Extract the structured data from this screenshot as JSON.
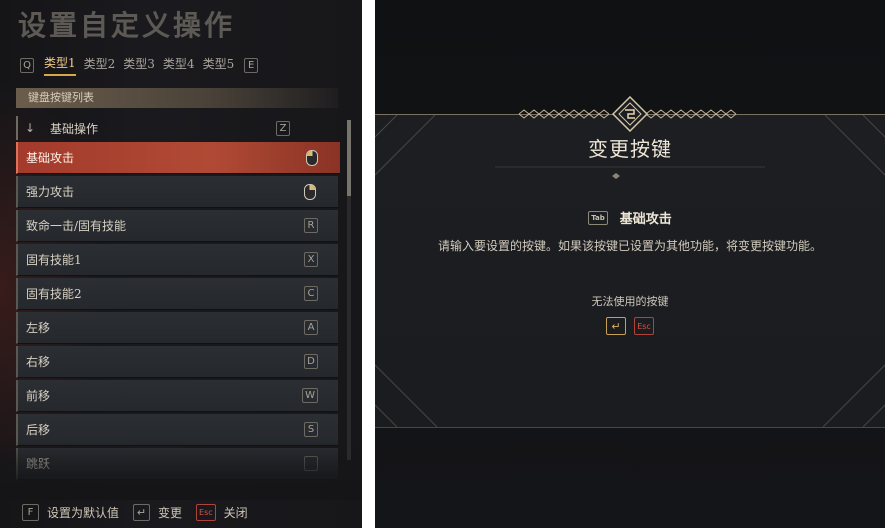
{
  "left_panel": {
    "title": "设置自定义操作",
    "tab_prev_key": "Q",
    "tab_next_key": "E",
    "tabs": [
      "类型1",
      "类型2",
      "类型3",
      "类型4",
      "类型5"
    ],
    "active_tab": 0,
    "section_header": "键盘按键列表",
    "category": {
      "label": "基础操作",
      "key": "Z",
      "icon": "arrow-down-icon"
    },
    "actions": [
      {
        "label": "基础攻击",
        "key": "",
        "icon": "mouse-left-icon",
        "selected": true
      },
      {
        "label": "强力攻击",
        "key": "",
        "icon": "mouse-right-icon",
        "selected": false
      },
      {
        "label": "致命一击/固有技能",
        "key": "R",
        "selected": false
      },
      {
        "label": "固有技能1",
        "key": "X",
        "selected": false
      },
      {
        "label": "固有技能2",
        "key": "C",
        "selected": false
      },
      {
        "label": "左移",
        "key": "A",
        "selected": false
      },
      {
        "label": "右移",
        "key": "D",
        "selected": false
      },
      {
        "label": "前移",
        "key": "W",
        "selected": false
      },
      {
        "label": "后移",
        "key": "S",
        "selected": false
      },
      {
        "label": "跳跃",
        "key": "",
        "selected": false
      }
    ],
    "footer": [
      {
        "key": "F",
        "label": "设置为默认值"
      },
      {
        "key": "↵",
        "label": "变更"
      },
      {
        "key": "Esc",
        "label": "关闭"
      }
    ]
  },
  "dialog": {
    "title": "变更按键",
    "action_key": "Tab",
    "action_name": "基础攻击",
    "message": "请输入要设置的按键。如果该按键已设置为其他功能，将变更按键功能。",
    "unusable_label": "无法使用的按键",
    "unusable_keys": [
      "↵",
      "Esc"
    ]
  },
  "colors": {
    "accent_gold": "#d9b26a",
    "selected_red": "#a33a2c",
    "esc_red": "#d0554a"
  }
}
